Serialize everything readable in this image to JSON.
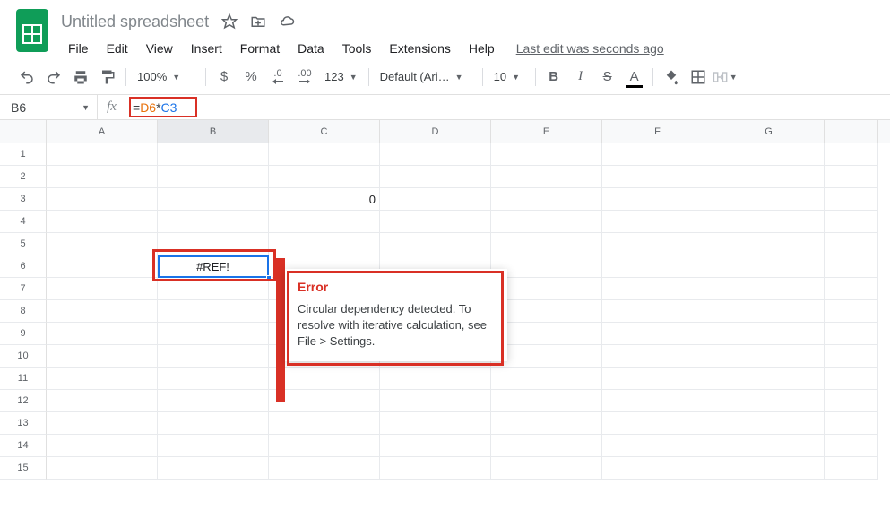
{
  "doc": {
    "title": "Untitled spreadsheet"
  },
  "menus": [
    "File",
    "Edit",
    "View",
    "Insert",
    "Format",
    "Data",
    "Tools",
    "Extensions",
    "Help"
  ],
  "last_edit": "Last edit was seconds ago",
  "toolbar": {
    "zoom": "100%",
    "font": "Default (Ari…",
    "font_size": "10",
    "currency_symbol": "$",
    "percent_symbol": "%",
    "dec_decrease": ".0",
    "dec_increase": ".00",
    "num_fmt": "123"
  },
  "formula_bar": {
    "name_box": "B6",
    "fx": "fx",
    "formula_eq": "=",
    "ref1": "D6",
    "op": "*",
    "ref2": "C3"
  },
  "grid": {
    "columns": [
      "A",
      "B",
      "C",
      "D",
      "E",
      "F",
      "G",
      ""
    ],
    "rows": [
      "1",
      "2",
      "3",
      "4",
      "5",
      "6",
      "7",
      "8",
      "9",
      "10",
      "11",
      "12",
      "13",
      "14",
      "15"
    ],
    "active_cell": "B6",
    "cells": {
      "C3": "0",
      "B6": "#REF!"
    }
  },
  "error_popup": {
    "title": "Error",
    "message": "Circular dependency detected. To resolve with iterative calculation, see File > Settings."
  }
}
